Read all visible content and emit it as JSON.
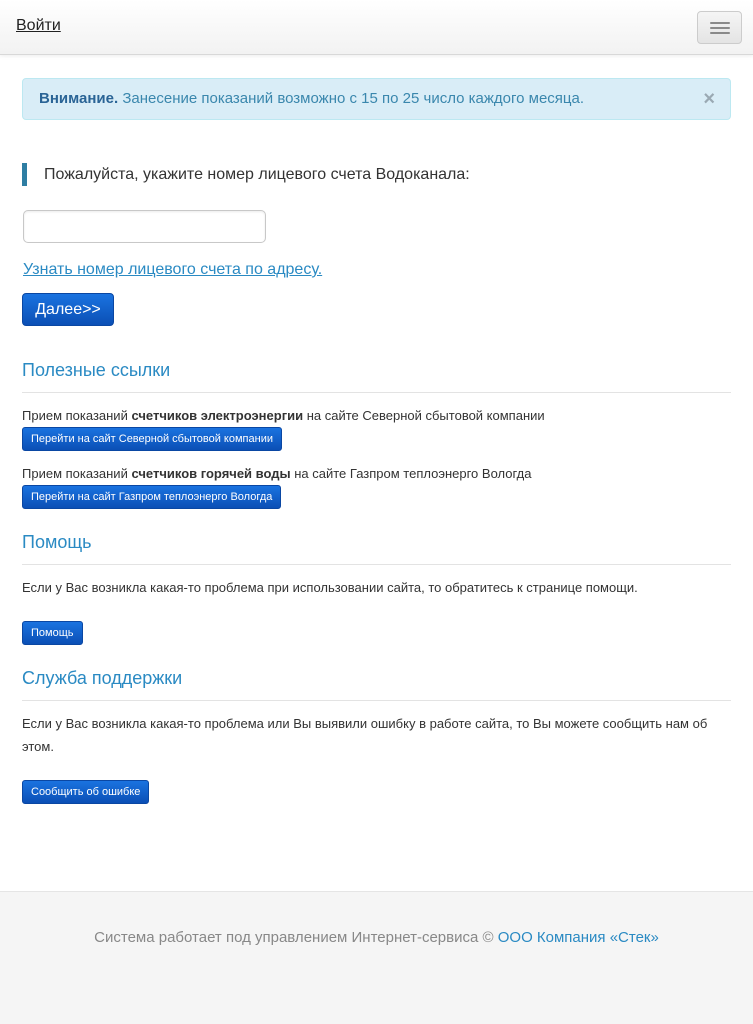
{
  "navbar": {
    "login_label": "Войти",
    "menu_icon": "hamburger-icon"
  },
  "alert": {
    "strong": "Внимание.",
    "text": "Занесение показаний возможно с 15 по 25 число каждого месяца.",
    "close": "×"
  },
  "form": {
    "prompt": "Пожалуйста, укажите номер лицевого счета Водоканала:",
    "account_value": "",
    "lookup_link": "Узнать номер лицевого счета по адресу.",
    "next_button": "Далее>>"
  },
  "useful_links": {
    "title": "Полезные ссылки",
    "items": [
      {
        "prefix": "Прием показаний ",
        "strong": "счетчиков электроэнергии",
        "suffix": " на сайте Северной сбытовой компании",
        "button": "Перейти на сайт Северной сбытовой компании"
      },
      {
        "prefix": "Прием показаний ",
        "strong": "счетчиков горячей воды",
        "suffix": " на сайте Газпром теплоэнерго Вологда",
        "button": "Перейти на сайт Газпром теплоэнерго Вологда"
      }
    ]
  },
  "help": {
    "title": "Помощь",
    "text": "Если у Вас возникла какая-то проблема при использовании сайта, то обратитесь к странице помощи.",
    "button": "Помощь"
  },
  "support": {
    "title": "Служба поддержки",
    "text_line1": "Если у Вас возникла какая-то проблема или Вы выявили ошибку в работе сайта, то Вы можете сообщить нам об",
    "text_line2": "этом.",
    "button": "Сообщить об ошибке"
  },
  "footer": {
    "text": "Система работает под управлением Интернет-сервиса © ",
    "link": "ООО Компания «Стек»"
  },
  "colors": {
    "accent": "#2a8ac3",
    "button": "#0b4fb5",
    "alert_bg": "#d9edf7"
  }
}
